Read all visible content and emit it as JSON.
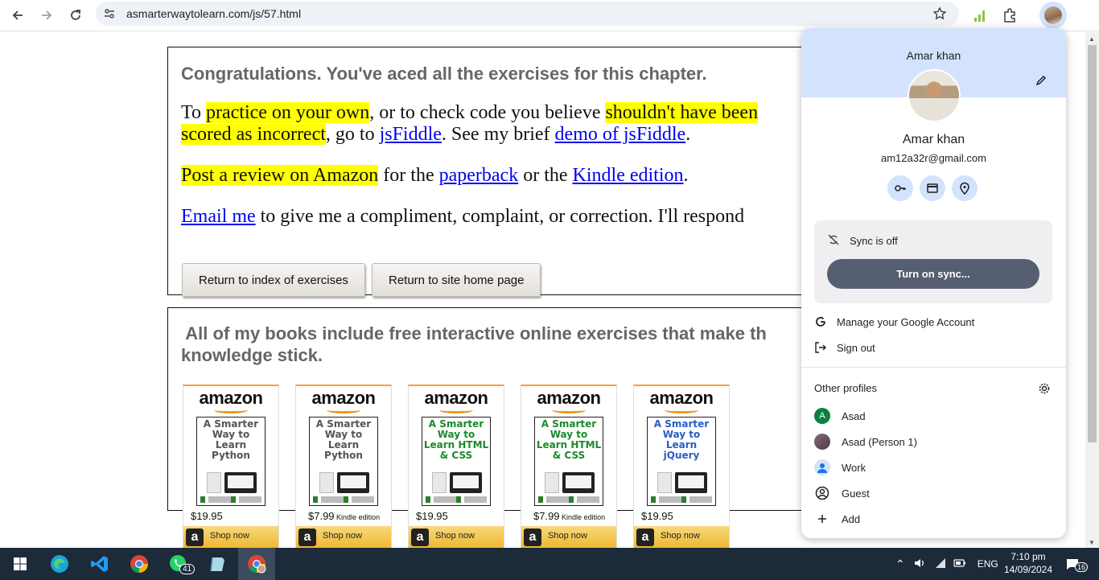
{
  "browser": {
    "url": "asmarterwaytolearn.com/js/57.html"
  },
  "page": {
    "congrats": "Congratulations. You've aced all the exercises for this chapter.",
    "p1": {
      "t1": "To ",
      "h1": "practice on your own",
      "t2": ", or to check code you believe ",
      "h2": "shouldn't have been",
      "h3": "scored as incorrect",
      "t3": ", go to ",
      "link1": "jsFiddle",
      "t4": ". See my brief ",
      "link2": "demo of jsFiddle",
      "t5": "."
    },
    "p2": {
      "h1": "Post a review on Amazon",
      "t1": " for the ",
      "link1": "paperback",
      "t2": " or the ",
      "link2": "Kindle edition",
      "t3": "."
    },
    "p3": {
      "link1": "Email me",
      "t1": " to give me a compliment, complaint, or correction. I'll respond"
    },
    "buttons": {
      "index": "Return to index of exercises",
      "home": "Return to site home page"
    },
    "books_heading_line1": " All of my books include free interactive online exercises that make th",
    "books_heading_line2": "knowledge stick.",
    "books": [
      {
        "brand": "amazon",
        "title": "A Smarter Way to Learn Python",
        "price": "$19.95",
        "price_note": "",
        "shop": "Shop now",
        "title_color": "#555555"
      },
      {
        "brand": "amazon",
        "title": "A Smarter Way to Learn Python",
        "price": "$7.99",
        "price_note": " Kindle edition",
        "shop": "Shop now",
        "title_color": "#555555"
      },
      {
        "brand": "amazon",
        "title": "A Smarter Way to Learn HTML & CSS",
        "price": "$19.95",
        "price_note": "",
        "shop": "Shop now",
        "title_color": "#1a8a2a"
      },
      {
        "brand": "amazon",
        "title": "A Smarter Way to Learn HTML & CSS",
        "price": "$7.99",
        "price_note": " Kindle edition",
        "shop": "Shop now",
        "title_color": "#1a8a2a"
      },
      {
        "brand": "amazon",
        "title": "A Smarter Way to Learn jQuery",
        "price": "$19.95",
        "price_note": "",
        "shop": "Shop now",
        "title_color": "#2a5cc8"
      }
    ]
  },
  "profile_menu": {
    "header_name": "Amar khan",
    "name": "Amar khan",
    "email": "am12a32r@gmail.com",
    "sync_status": "Sync is off",
    "sync_button": "Turn on sync...",
    "manage_account": "Manage your Google Account",
    "sign_out": "Sign out",
    "other_profiles_label": "Other profiles",
    "profiles": [
      {
        "name": "Asad",
        "initial": "A",
        "color": "#0b8043"
      },
      {
        "name": "Asad (Person 1)",
        "initial": "",
        "color": "#6b4a5c"
      },
      {
        "name": "Work",
        "initial": "",
        "color": "#1a73e8"
      },
      {
        "name": "Guest",
        "initial": "",
        "color": ""
      }
    ],
    "add": "Add"
  },
  "taskbar": {
    "whatsapp_badge": "41",
    "language": "ENG",
    "time": "7:10 pm",
    "date": "14/09/2024",
    "notification_count": "16"
  }
}
